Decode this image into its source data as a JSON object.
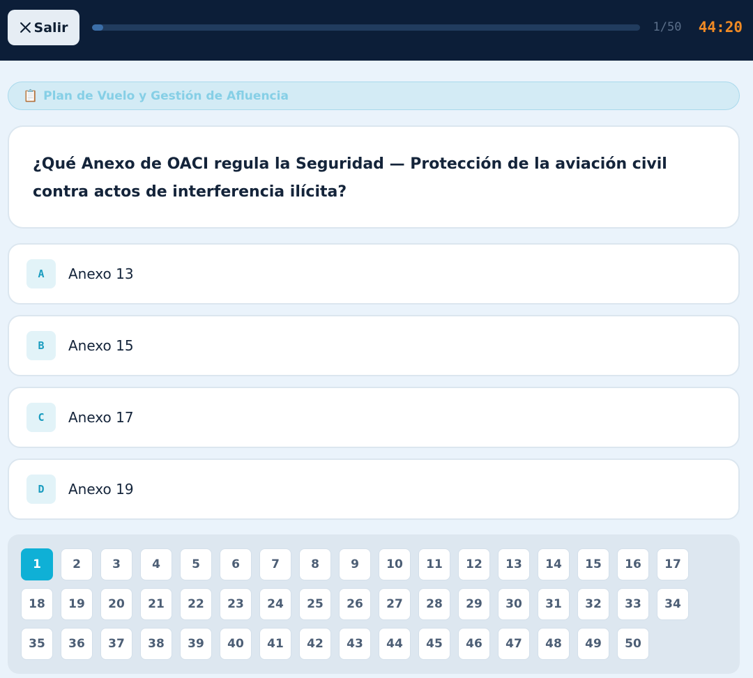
{
  "header": {
    "exit_label": "Salir",
    "progress_text": "1/50",
    "progress_fraction": 0.02,
    "timer": "44:20"
  },
  "category": {
    "icon": "clipboard-icon",
    "label": "Plan de Vuelo y Gestión de Afluencia"
  },
  "question": {
    "text": "¿Qué Anexo de OACI regula la Seguridad — Protección de la aviación civil contra actos de interferencia ilícita?"
  },
  "options": [
    {
      "letter": "A",
      "text": "Anexo 13"
    },
    {
      "letter": "B",
      "text": "Anexo 15"
    },
    {
      "letter": "C",
      "text": "Anexo 17"
    },
    {
      "letter": "D",
      "text": "Anexo 19"
    }
  ],
  "navigator": {
    "current": 1,
    "numbers": [
      "1",
      "2",
      "3",
      "4",
      "5",
      "6",
      "7",
      "8",
      "9",
      "10",
      "11",
      "12",
      "13",
      "14",
      "15",
      "16",
      "17",
      "18",
      "19",
      "20",
      "21",
      "22",
      "23",
      "24",
      "25",
      "26",
      "27",
      "28",
      "29",
      "30",
      "31",
      "32",
      "33",
      "34",
      "35",
      "36",
      "37",
      "38",
      "39",
      "40",
      "41",
      "42",
      "43",
      "44",
      "45",
      "46",
      "47",
      "48",
      "49",
      "50"
    ]
  },
  "colors": {
    "accent": "#0fb0d6",
    "timer": "#f08a24",
    "header_bg": "#0c1e38"
  }
}
